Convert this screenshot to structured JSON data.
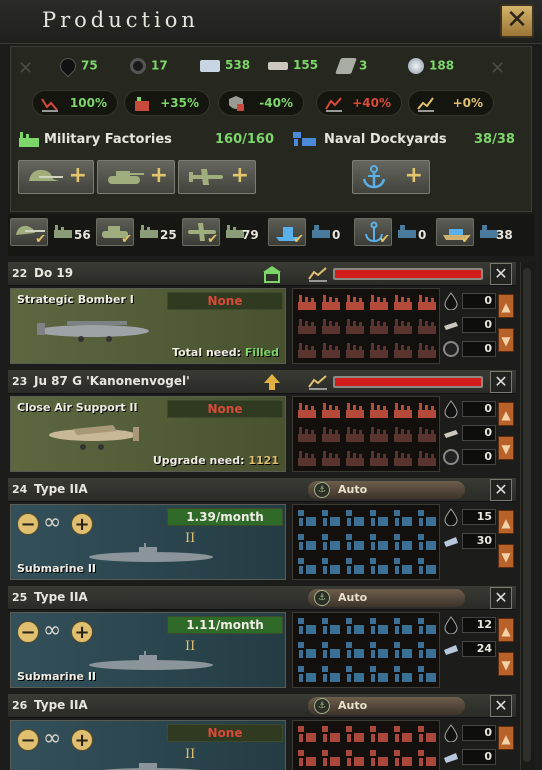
{
  "window": {
    "title": "Production"
  },
  "resources": [
    {
      "name": "oil",
      "value": "75",
      "color": "#1b1b1b"
    },
    {
      "name": "rubber",
      "value": "17",
      "color": "#222"
    },
    {
      "name": "aluminium",
      "value": "538",
      "color": "#c7d4e2"
    },
    {
      "name": "tungsten",
      "value": "155",
      "color": "#ccc8bd"
    },
    {
      "name": "steel",
      "value": "3",
      "color": "#a9aba5"
    },
    {
      "name": "chromium",
      "value": "188",
      "color": "#cfd7df"
    }
  ],
  "modifiers": [
    {
      "name": "factory-output",
      "value": "100%",
      "color": "#7cd66a"
    },
    {
      "name": "production-efficiency",
      "value": "+35%",
      "color": "#7cd66a"
    },
    {
      "name": "consumer-goods",
      "value": "-40%",
      "color": "#7cd66a"
    },
    {
      "name": "dockyard-output",
      "value": "+40%",
      "color": "#d84a3a"
    },
    {
      "name": "efficiency-gain",
      "value": "+0%",
      "color": "#e0c070"
    }
  ],
  "factories": {
    "military_label": "Military Factories",
    "military_count": "160/160",
    "naval_label": "Naval Dockyards",
    "naval_count": "38/38"
  },
  "category_tabs": [
    {
      "name": "land",
      "count": "56"
    },
    {
      "name": "armor",
      "count": "25"
    },
    {
      "name": "air",
      "count": "79"
    },
    {
      "name": "naval-capital",
      "count": "0"
    },
    {
      "name": "naval-anchor",
      "count": "0"
    },
    {
      "name": "naval-convoy",
      "count": "38"
    }
  ],
  "production_lines": [
    {
      "index": "22",
      "name": "Do 19",
      "type": "Strategic Bomber I",
      "badge": "None",
      "need_label": "Total need:",
      "need_value": "Filled",
      "need_color": "#7cd66a",
      "kind": "air",
      "side": [
        "0",
        "0",
        "0"
      ]
    },
    {
      "index": "23",
      "name": "Ju 87 G 'Kanonenvogel'",
      "type": "Close Air Support II",
      "badge": "None",
      "need_label": "Upgrade need:",
      "need_value": "1121",
      "need_color": "#e0c070",
      "kind": "air",
      "side": [
        "0",
        "0",
        "0"
      ]
    },
    {
      "index": "24",
      "name": "Type IIA",
      "type": "Submarine II",
      "badge": "1.39/month",
      "auto": "Auto",
      "rank": "II",
      "kind": "sea",
      "side": [
        "15",
        "30"
      ]
    },
    {
      "index": "25",
      "name": "Type IIA",
      "type": "Submarine II",
      "badge": "1.11/month",
      "auto": "Auto",
      "rank": "II",
      "kind": "sea",
      "side": [
        "12",
        "24"
      ]
    },
    {
      "index": "26",
      "name": "Type IIA",
      "type": "",
      "badge": "None",
      "auto": "Auto",
      "rank": "II",
      "kind": "sea",
      "side": [
        "0",
        "0"
      ]
    }
  ],
  "labels": {
    "close": "✕",
    "plus": "+",
    "minus": "−",
    "infinity": "∞"
  }
}
